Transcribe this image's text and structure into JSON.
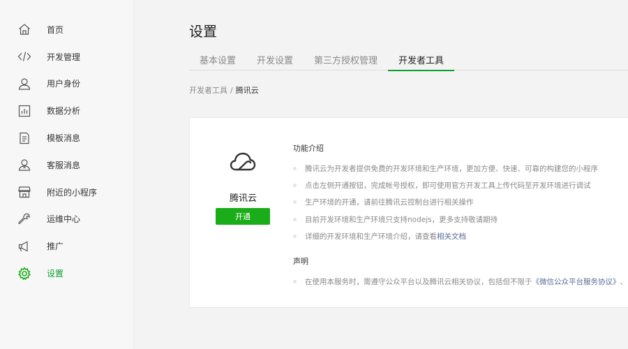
{
  "sidebar": {
    "items": [
      {
        "label": "首页",
        "icon": "home-icon",
        "active": false
      },
      {
        "label": "开发管理",
        "icon": "code-icon",
        "active": false
      },
      {
        "label": "用户身份",
        "icon": "user-icon",
        "active": false
      },
      {
        "label": "数据分析",
        "icon": "chart-icon",
        "active": false
      },
      {
        "label": "模板消息",
        "icon": "document-icon",
        "active": false
      },
      {
        "label": "客服消息",
        "icon": "customer-service-icon",
        "active": false
      },
      {
        "label": "附近的小程序",
        "icon": "store-icon",
        "active": false
      },
      {
        "label": "运维中心",
        "icon": "wrench-icon",
        "active": false
      },
      {
        "label": "推广",
        "icon": "megaphone-icon",
        "active": false
      },
      {
        "label": "设置",
        "icon": "gear-icon",
        "active": true
      }
    ]
  },
  "page": {
    "title": "设置"
  },
  "tabs": [
    {
      "label": "基本设置",
      "active": false
    },
    {
      "label": "开发设置",
      "active": false
    },
    {
      "label": "第三方授权管理",
      "active": false
    },
    {
      "label": "开发者工具",
      "active": true
    }
  ],
  "breadcrumb": {
    "parent": "开发者工具",
    "separator": "/",
    "current": "腾讯云"
  },
  "card": {
    "product_name": "腾讯云",
    "product_icon": "cloud-icon",
    "open_button": "开通",
    "intro_title": "功能介绍",
    "intro_items": [
      "腾讯云为开发者提供免费的开发环境和生产环境，更加方便、快速、可靠的构建您的小程序",
      "点击左侧开通按钮，完成帐号授权，即可使用官方开发工具上传代码至开发环境进行调试",
      "生产环境的开通，请前往腾讯云控制台进行相关操作",
      "目前开发环境和生产环境只支持nodejs，更多支持敬请期待"
    ],
    "intro_last_prefix": "详细的开发环境和生产环境介绍，请查看",
    "intro_last_link": "相关文档",
    "statement_title": "声明",
    "statement_prefix": "在使用本服务时，需遵守公众平台以及腾讯云相关协议，包括但不限于",
    "statement_link": "《微信公众平台服务协议》",
    "statement_suffix": "、"
  },
  "colors": {
    "accent": "#1aad19",
    "active_text": "#07a12e",
    "link": "#576b95"
  }
}
